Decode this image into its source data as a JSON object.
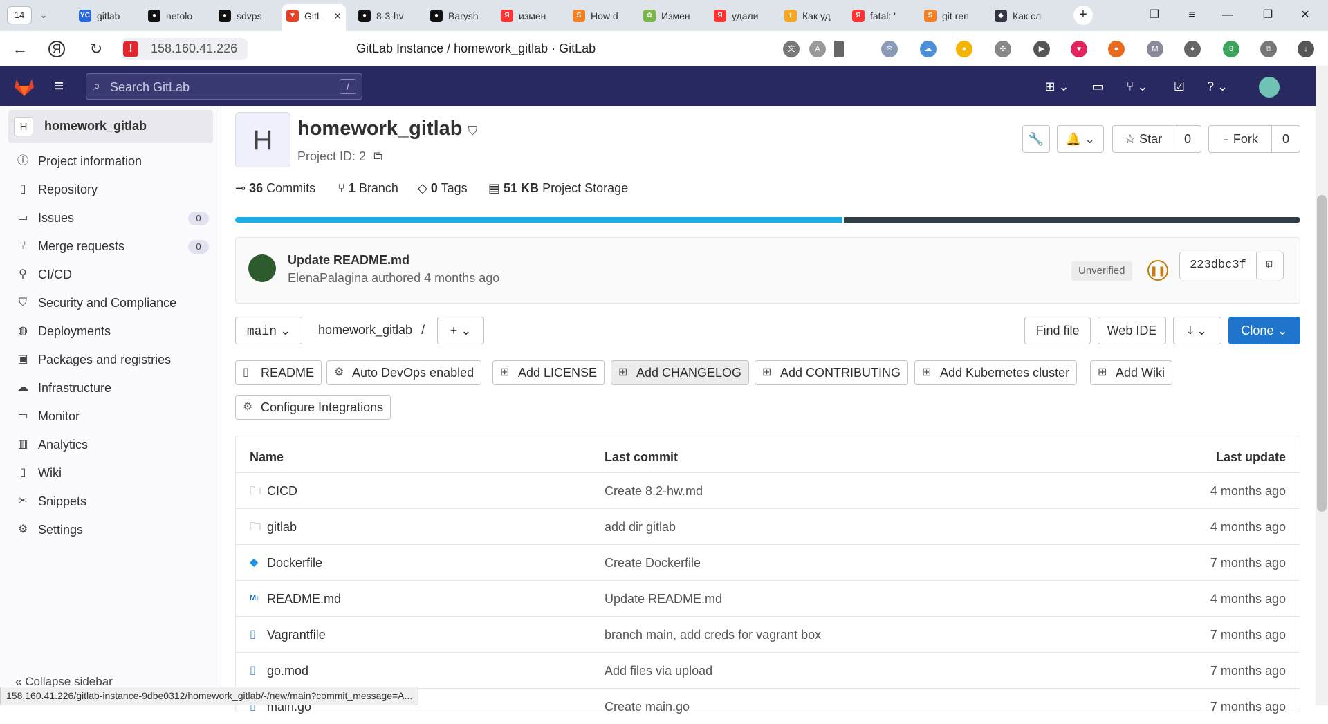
{
  "browser": {
    "tab_count": "14",
    "tabs": [
      "gitlab",
      "netolo",
      "sdvps",
      "GitL",
      "8-3-hv",
      "Barysh",
      "измен",
      "How d",
      "Измен",
      "удали",
      "Как уд",
      "fatal: '",
      "git ren",
      "Как сл"
    ],
    "url": "158.160.41.226",
    "page_title": "GitLab Instance / homework_gitlab · GitLab",
    "status_url": "158.160.41.226/gitlab-instance-9dbe0312/homework_gitlab/-/new/main?commit_message=A..."
  },
  "header": {
    "search_placeholder": "Search GitLab",
    "search_shortcut": "/"
  },
  "sidebar": {
    "project_initial": "H",
    "project_name": "homework_gitlab",
    "items": [
      {
        "label": "Project information",
        "icon": "info-icon"
      },
      {
        "label": "Repository",
        "icon": "doc-icon"
      },
      {
        "label": "Issues",
        "icon": "issues-icon",
        "count": "0"
      },
      {
        "label": "Merge requests",
        "icon": "merge-icon",
        "count": "0"
      },
      {
        "label": "CI/CD",
        "icon": "rocket-icon"
      },
      {
        "label": "Security and Compliance",
        "icon": "shield-icon"
      },
      {
        "label": "Deployments",
        "icon": "deploy-icon"
      },
      {
        "label": "Packages and registries",
        "icon": "package-icon"
      },
      {
        "label": "Infrastructure",
        "icon": "cloud-icon"
      },
      {
        "label": "Monitor",
        "icon": "monitor-icon"
      },
      {
        "label": "Analytics",
        "icon": "chart-icon"
      },
      {
        "label": "Wiki",
        "icon": "book-icon"
      },
      {
        "label": "Snippets",
        "icon": "scissors-icon"
      },
      {
        "label": "Settings",
        "icon": "gear-icon"
      }
    ],
    "collapse_label": "Collapse sidebar"
  },
  "project": {
    "initial": "H",
    "title": "homework_gitlab",
    "id_label": "Project ID: 2",
    "star_label": "Star",
    "star_count": "0",
    "fork_label": "Fork",
    "fork_count": "0",
    "commits_count": "36",
    "commits_label": "Commits",
    "branch_count": "1",
    "branch_label": "Branch",
    "tags_count": "0",
    "tags_label": "Tags",
    "storage_size": "51 KB",
    "storage_label": "Project Storage",
    "language_bar_fraction": 0.57,
    "language_colors": [
      "#1aaee4",
      "#2f3f48"
    ]
  },
  "commit": {
    "title": "Update README.md",
    "author_line": "ElenaPalagina authored 4 months ago",
    "badge": "Unverified",
    "sha": "223dbc3f"
  },
  "toolbar": {
    "branch": "main",
    "path": "homework_gitlab",
    "path_sep": "/",
    "find_file": "Find file",
    "web_ide": "Web IDE",
    "clone": "Clone",
    "clone_color": "#1f75cb"
  },
  "chips": [
    "README",
    "Auto DevOps enabled",
    "Add LICENSE",
    "Add CHANGELOG",
    "Add CONTRIBUTING",
    "Add Kubernetes cluster",
    "Add Wiki",
    "Configure Integrations"
  ],
  "files": {
    "headers": [
      "Name",
      "Last commit",
      "Last update"
    ],
    "rows": [
      {
        "name": "CICD",
        "icon": "folder-icon",
        "commit": "Create 8.2-hw.md",
        "updated": "4 months ago"
      },
      {
        "name": "gitlab",
        "icon": "folder-icon",
        "commit": "add dir gitlab",
        "updated": "4 months ago"
      },
      {
        "name": "Dockerfile",
        "icon": "docker-icon",
        "commit": "Create Dockerfile",
        "updated": "7 months ago"
      },
      {
        "name": "README.md",
        "icon": "markdown-icon",
        "commit": "Update README.md",
        "updated": "4 months ago"
      },
      {
        "name": "Vagrantfile",
        "icon": "file-icon",
        "commit": "branch main, add creds for vagrant box",
        "updated": "7 months ago"
      },
      {
        "name": "go.mod",
        "icon": "file-icon",
        "commit": "Add files via upload",
        "updated": "7 months ago"
      },
      {
        "name": "main.go",
        "icon": "file-icon",
        "commit": "Create main.go",
        "updated": "7 months ago"
      }
    ]
  }
}
